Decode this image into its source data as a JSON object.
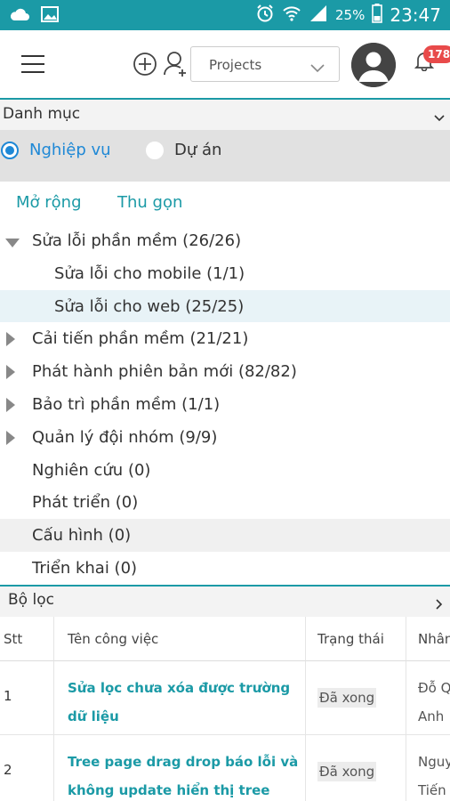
{
  "status_bar": {
    "battery_pct": "25%",
    "time": "23:47"
  },
  "toolbar": {
    "project_select": "Projects",
    "notification_count": "178"
  },
  "category": {
    "title": "Danh mục",
    "radio_options": [
      {
        "label": "Nghiệp vụ",
        "selected": true
      },
      {
        "label": "Dự án",
        "selected": false
      }
    ],
    "expand_label": "Mở rộng",
    "collapse_label": "Thu gọn"
  },
  "tree": [
    {
      "label": "Sửa lỗi phần mềm (26/26)",
      "level": 0,
      "state": "expanded"
    },
    {
      "label": "Sửa lỗi cho mobile (1/1)",
      "level": 1,
      "state": "leaf"
    },
    {
      "label": "Sửa lỗi cho web (25/25)",
      "level": 1,
      "state": "leaf",
      "selected": true
    },
    {
      "label": "Cải tiến phần mềm (21/21)",
      "level": 0,
      "state": "collapsed"
    },
    {
      "label": "Phát hành phiên bản mới (82/82)",
      "level": 0,
      "state": "collapsed"
    },
    {
      "label": "Bảo trì phần mềm (1/1)",
      "level": 0,
      "state": "collapsed"
    },
    {
      "label": "Quản lý đội nhóm (9/9)",
      "level": 0,
      "state": "collapsed"
    },
    {
      "label": "Nghiên cứu (0)",
      "level": 0,
      "state": "leaf"
    },
    {
      "label": "Phát triển (0)",
      "level": 0,
      "state": "leaf"
    },
    {
      "label": "Cấu hình (0)",
      "level": 0,
      "state": "leaf",
      "shaded": true
    },
    {
      "label": "Triển khai (0)",
      "level": 0,
      "state": "leaf"
    }
  ],
  "filter": {
    "title": "Bộ lọc"
  },
  "table": {
    "headers": [
      "Stt",
      "Tên công việc",
      "Trạng thái",
      "Nhân"
    ],
    "rows": [
      {
        "stt": "1",
        "name": "Sửa lọc chưa xóa được trường dữ liệu",
        "status": "Đã xong",
        "assignee": "Đỗ Q\nAnh"
      },
      {
        "stt": "2",
        "name": "Tree page drag drop báo lỗi và không update hiển thị tree",
        "status": "Đã xong",
        "assignee": "Nguy\nTiến"
      }
    ]
  },
  "colors": {
    "primary": "#1b9aa6",
    "accent_blue": "#1e88d6",
    "badge_red": "#e84a4a"
  }
}
